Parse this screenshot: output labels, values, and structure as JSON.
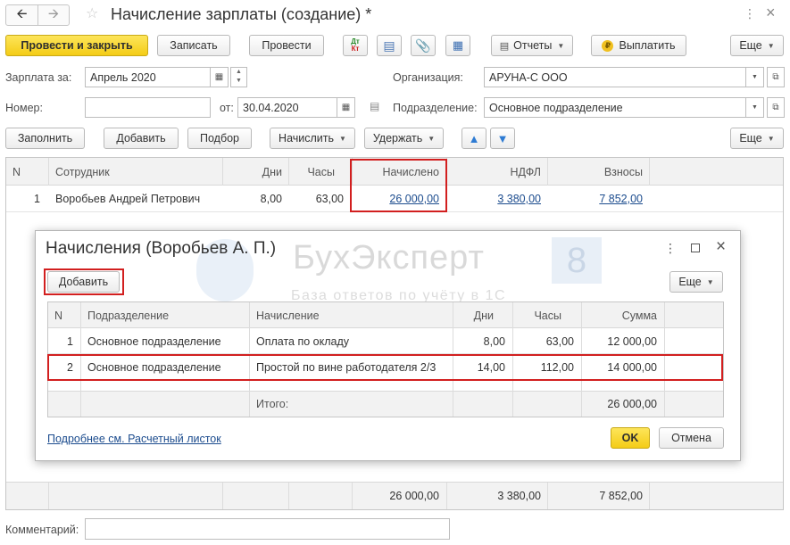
{
  "window": {
    "title": "Начисление зарплаты (создание) *"
  },
  "toolbar": {
    "post_close": "Провести и закрыть",
    "save": "Записать",
    "post": "Провести",
    "dtkt_top": "Дт",
    "dtkt_bottom": "Кт",
    "reports": "Отчеты",
    "pay": "Выплатить",
    "more": "Еще"
  },
  "header": {
    "salary_for_label": "Зарплата за:",
    "salary_for_value": "Апрель 2020",
    "org_label": "Организация:",
    "org_value": "АРУНА-С ООО",
    "number_label": "Номер:",
    "number_value": "",
    "from_label": "от:",
    "from_value": "30.04.2020",
    "dept_label": "Подразделение:",
    "dept_value": "Основное подразделение"
  },
  "table_toolbar": {
    "fill": "Заполнить",
    "add": "Добавить",
    "pick": "Подбор",
    "accrue": "Начислить",
    "withhold": "Удержать",
    "more": "Еще"
  },
  "main_table": {
    "columns": [
      "N",
      "Сотрудник",
      "Дни",
      "Часы",
      "Начислено",
      "НДФЛ",
      "Взносы"
    ],
    "rows": [
      {
        "n": "1",
        "employee": "Воробьев Андрей Петрович",
        "days": "8,00",
        "hours": "63,00",
        "accrued": "26 000,00",
        "ndfl": "3 380,00",
        "contrib": "7 852,00"
      }
    ],
    "totals": {
      "accrued": "26 000,00",
      "ndfl": "3 380,00",
      "contrib": "7 852,00"
    }
  },
  "comment": {
    "label": "Комментарий:",
    "value": ""
  },
  "watermark": {
    "brand": "БухЭксперт",
    "digit": "8",
    "tagline": "База ответов по учёту в 1С"
  },
  "dialog": {
    "title": "Начисления (Воробьев А. П.)",
    "add": "Добавить",
    "more": "Еще",
    "columns": [
      "N",
      "Подразделение",
      "Начисление",
      "Дни",
      "Часы",
      "Сумма"
    ],
    "rows": [
      {
        "n": "1",
        "dept": "Основное подразделение",
        "accrual": "Оплата по окладу",
        "days": "8,00",
        "hours": "63,00",
        "sum": "12 000,00"
      },
      {
        "n": "2",
        "dept": "Основное подразделение",
        "accrual": "Простой по вине работодателя 2/3",
        "days": "14,00",
        "hours": "112,00",
        "sum": "14 000,00"
      }
    ],
    "total_label": "Итого:",
    "total_sum": "26 000,00",
    "link": "Подробнее см. Расчетный листок",
    "ok": "OK",
    "cancel": "Отмена"
  },
  "colors": {
    "accent_yellow": "#f4cc16",
    "highlight_red": "#d21f1f",
    "link_blue": "#1c4c8e"
  }
}
